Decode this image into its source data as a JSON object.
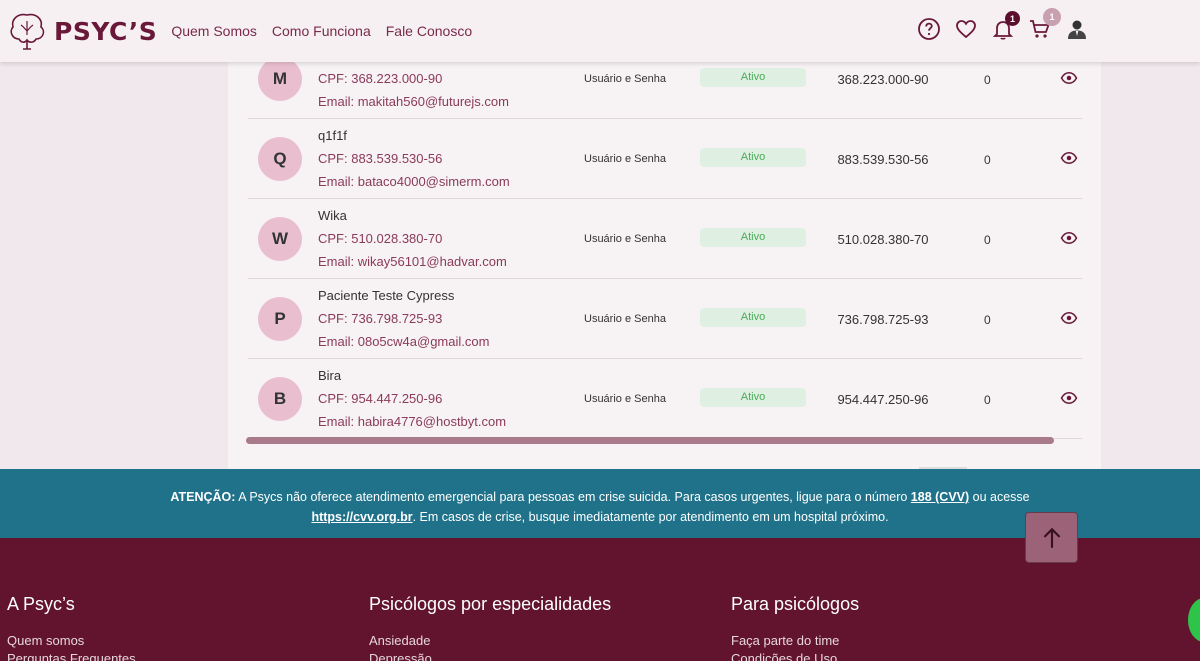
{
  "header": {
    "logo_text": "PSYC’S",
    "nav": [
      "Quem Somos",
      "Como Funciona",
      "Fale Conosco"
    ],
    "notification_count": "1",
    "cart_count": "1"
  },
  "rows": [
    {
      "initial": "M",
      "name": "",
      "cpf": "CPF: 368.223.000-90",
      "email": "Email: makitah560@futurejs.com",
      "login": "Usuário e Senha",
      "status": "Ativo",
      "doc": "368.223.000-90",
      "count": "0"
    },
    {
      "initial": "Q",
      "name": "q1f1f",
      "cpf": "CPF: 883.539.530-56",
      "email": "Email: bataco4000@simerm.com",
      "login": "Usuário e Senha",
      "status": "Ativo",
      "doc": "883.539.530-56",
      "count": "0"
    },
    {
      "initial": "W",
      "name": "Wika",
      "cpf": "CPF: 510.028.380-70",
      "email": "Email: wikay56101@hadvar.com",
      "login": "Usuário e Senha",
      "status": "Ativo",
      "doc": "510.028.380-70",
      "count": "0"
    },
    {
      "initial": "P",
      "name": "Paciente Teste Cypress",
      "cpf": "CPF: 736.798.725-93",
      "email": "Email: 08o5cw4a@gmail.com",
      "login": "Usuário e Senha",
      "status": "Ativo",
      "doc": "736.798.725-93",
      "count": "0"
    },
    {
      "initial": "B",
      "name": "Bira",
      "cpf": "CPF: 954.447.250-96",
      "email": "Email: habira4776@hostbyt.com",
      "login": "Usuário e Senha",
      "status": "Ativo",
      "doc": "954.447.250-96",
      "count": "0"
    }
  ],
  "alert": {
    "label": "ATENÇÃO:",
    "text1": " A Psycs não oferece atendimento emergencial para pessoas em crise suicida. Para casos urgentes, ligue para o número ",
    "phone": "188 (CVV)",
    "text2": " ou acesse",
    "url": "https://cvv.org.br",
    "text3": ". Em casos de crise, busque imediatamente por atendimento em um hospital próximo."
  },
  "footer": {
    "col1": {
      "title": "A Psyc’s",
      "items": [
        "Quem somos",
        "Perguntas Frequentes"
      ]
    },
    "col2": {
      "title": "Psicólogos por especialidades",
      "items": [
        "Ansiedade",
        "Depressão"
      ]
    },
    "col3": {
      "title": "Para psicólogos",
      "items": [
        "Faça parte do time",
        "Condições de Uso"
      ]
    }
  },
  "colors": {
    "brand": "#6a1839",
    "alert_bg": "#1f7289",
    "footer_bg": "#62142f",
    "status_green": "#4caa5a"
  }
}
